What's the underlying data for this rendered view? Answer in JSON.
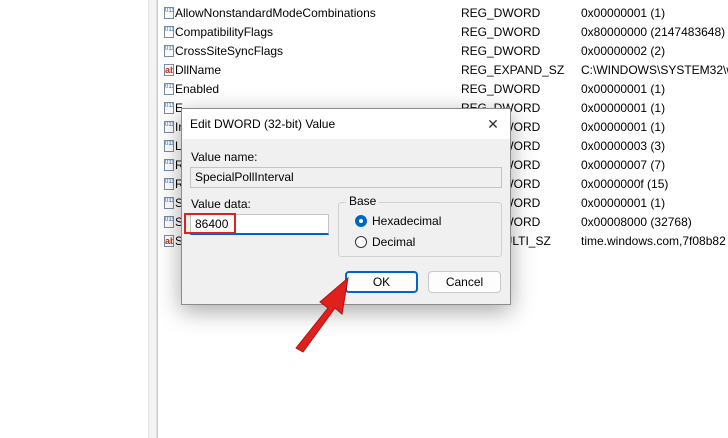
{
  "registry_rows": [
    {
      "name": "AllowNonstandardModeCombinations",
      "type": "REG_DWORD",
      "data": "0x00000001 (1)",
      "icon": "dword"
    },
    {
      "name": "CompatibilityFlags",
      "type": "REG_DWORD",
      "data": "0x80000000 (2147483648)",
      "icon": "dword"
    },
    {
      "name": "CrossSiteSyncFlags",
      "type": "REG_DWORD",
      "data": "0x00000002 (2)",
      "icon": "dword"
    },
    {
      "name": "DllName",
      "type": "REG_EXPAND_SZ",
      "data": "C:\\WINDOWS\\SYSTEM32\\w",
      "icon": "sz"
    },
    {
      "name": "Enabled",
      "type": "REG_DWORD",
      "data": "0x00000001 (1)",
      "icon": "dword"
    },
    {
      "name": "E",
      "type": "REG_DWORD",
      "data": "0x00000001 (1)",
      "icon": "dword"
    },
    {
      "name": "In",
      "type": "REG_DWORD",
      "data": "0x00000001 (1)",
      "icon": "dword"
    },
    {
      "name": "L",
      "type": "REG_DWORD",
      "data": "0x00000003 (3)",
      "icon": "dword"
    },
    {
      "name": "R",
      "type": "REG_DWORD",
      "data": "0x00000007 (7)",
      "icon": "dword"
    },
    {
      "name": "R",
      "type": "REG_DWORD",
      "data": "0x0000000f (15)",
      "icon": "dword"
    },
    {
      "name": "S",
      "type": "REG_DWORD",
      "data": "0x00000001 (1)",
      "icon": "dword"
    },
    {
      "name": "S",
      "type": "REG_DWORD",
      "data": "0x00008000 (32768)",
      "icon": "dword"
    },
    {
      "name": "S",
      "type": "REG_MULTI_SZ",
      "data": "time.windows.com,7f08b82",
      "icon": "sz"
    }
  ],
  "dialog": {
    "title": "Edit DWORD (32-bit) Value",
    "value_name_label": "Value name:",
    "value_name": "SpecialPollInterval",
    "value_data_label": "Value data:",
    "value_data": "86400",
    "base_label": "Base",
    "base_options": [
      "Hexadecimal",
      "Decimal"
    ],
    "base_selected": "Hexadecimal",
    "ok_label": "OK",
    "cancel_label": "Cancel"
  },
  "colors": {
    "accent": "#0067c0",
    "highlight": "#e0201c"
  }
}
